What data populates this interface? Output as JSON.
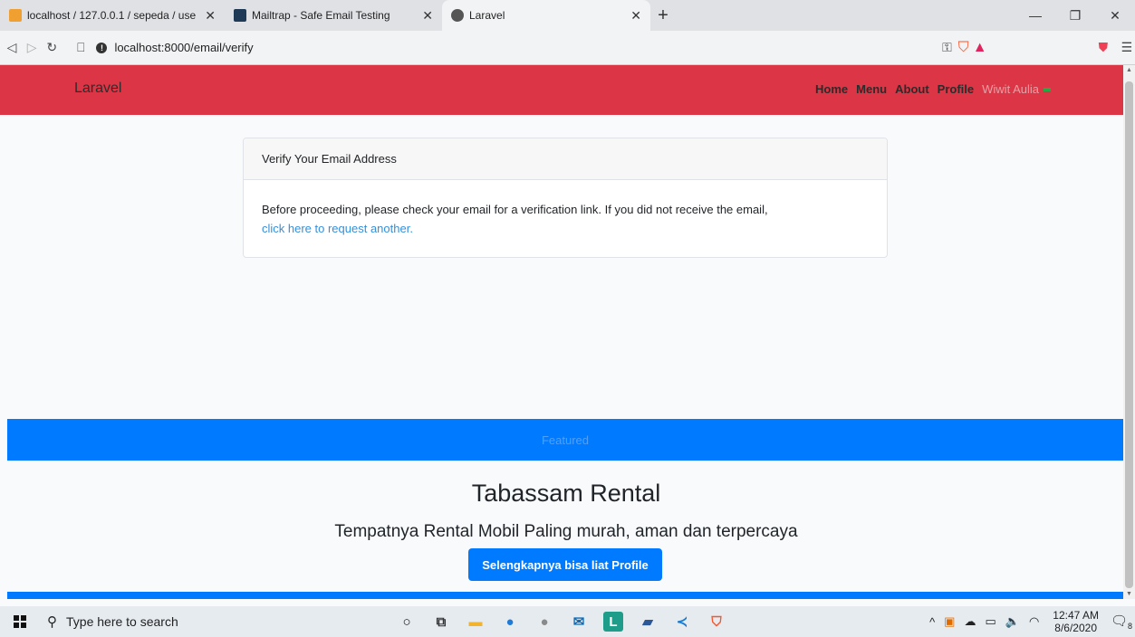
{
  "browser": {
    "tabs": [
      {
        "title": "localhost / 127.0.0.1 / sepeda / use",
        "close": "✕"
      },
      {
        "title": "Mailtrap - Safe Email Testing",
        "close": "✕"
      },
      {
        "title": "Laravel",
        "close": "✕"
      }
    ],
    "new_tab": "+",
    "window_controls": {
      "minimize": "—",
      "restore": "❐",
      "close": "✕"
    },
    "url": "localhost:8000/email/verify",
    "icons": {
      "back": "back-icon",
      "forward": "forward-icon",
      "reload": "reload-icon",
      "bookmark": "bookmark-icon",
      "info": "info-icon",
      "key": "key-icon",
      "brave_shield": "brave-shield-icon",
      "brave_rewards": "brave-rewards-icon",
      "pocket": "pocket-icon",
      "menu": "menu-icon"
    }
  },
  "navbar": {
    "brand": "Laravel",
    "links": [
      "Home",
      "Menu",
      "About",
      "Profile"
    ],
    "user": "Wiwit Aulia",
    "color": "#dc3545"
  },
  "card": {
    "header": "Verify Your Email Address",
    "body": "Before proceeding, please check your email for a verification link. If you did not receive the email,",
    "link": "click here to request another",
    "link_suffix": "."
  },
  "featured": {
    "label": "Featured",
    "color": "#007bff"
  },
  "jumbotron": {
    "title": "Tabassam Rental",
    "subtitle": "Tempatnya Rental Mobil Paling murah, aman dan terpercaya",
    "button": "Selengkapnya bisa liat Profile"
  },
  "taskbar": {
    "search_placeholder": "Type here to search",
    "time": "12:47 AM",
    "date": "8/6/2020",
    "notification_count": "8"
  }
}
